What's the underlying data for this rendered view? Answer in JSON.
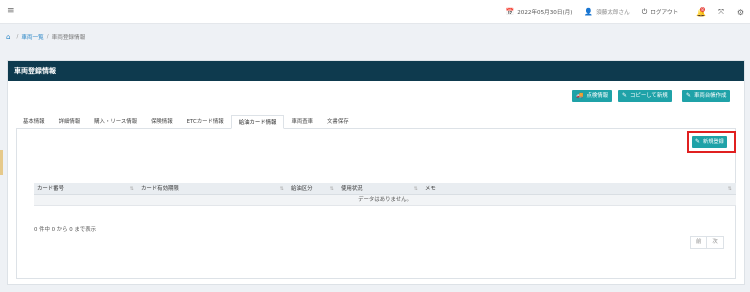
{
  "header": {
    "date_text": "2022年05月30日(月)",
    "user_text": "須藤太郎さん",
    "logout_label": "ログアウト",
    "notification_count": "8"
  },
  "breadcrumb": {
    "items": [
      "車両一覧",
      "車両登録情報"
    ]
  },
  "panel": {
    "title": "車両登録情報",
    "actions": {
      "inspection_label": "点検情報",
      "copy_label": "コピーして新規",
      "ledger_label": "車両台帳作成"
    }
  },
  "tabs": [
    {
      "label": "基本情報"
    },
    {
      "label": "詳細情報"
    },
    {
      "label": "購入・リース情報"
    },
    {
      "label": "保険情報"
    },
    {
      "label": "ETCカード情報"
    },
    {
      "label": "給油カード情報"
    },
    {
      "label": "車両査車"
    },
    {
      "label": "文書保存"
    }
  ],
  "active_tab": "給油カード情報",
  "fuel_card": {
    "new_button_label": "新規登録",
    "columns": [
      "カード番号",
      "カード有効期限",
      "給油区分",
      "使用状況",
      "メモ"
    ],
    "empty_text": "データはありません。",
    "info_text": "0 件中 0 から 0 まで表示",
    "pager": {
      "prev": "前",
      "next": "次"
    }
  },
  "colors": {
    "panel_header": "#0e3a4e",
    "button_teal": "#1fa2a8",
    "highlight_red": "#e02020",
    "link_blue": "#2a86c6"
  }
}
